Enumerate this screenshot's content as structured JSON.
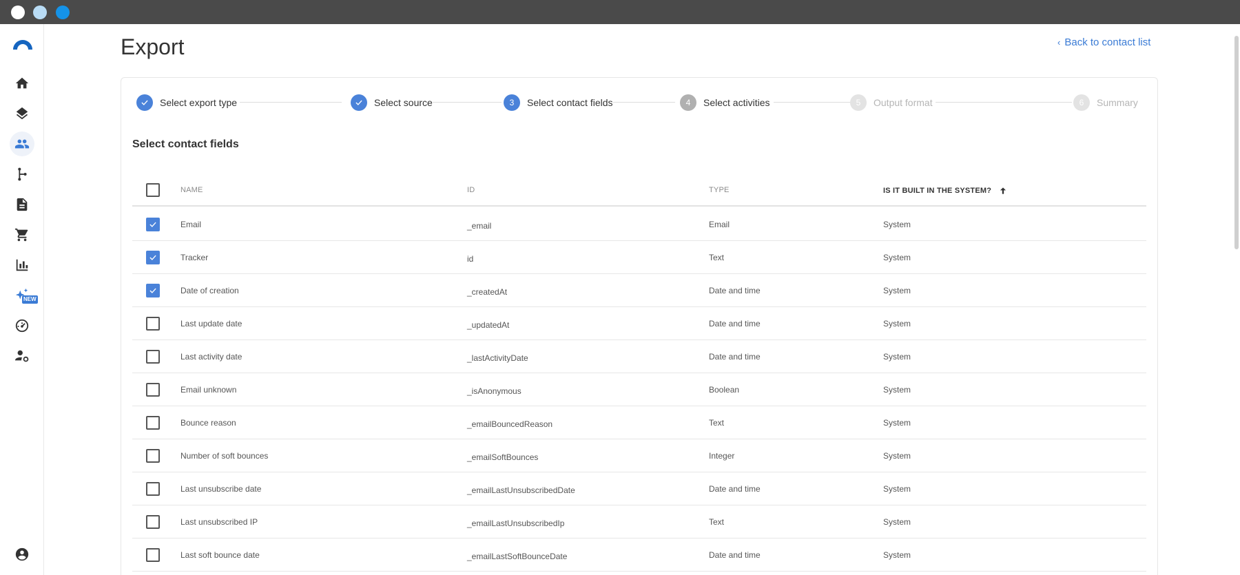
{
  "page": {
    "title": "Export",
    "back_link": "Back to contact list"
  },
  "stepper": [
    {
      "number": "1",
      "label": "Select export type",
      "state": "done"
    },
    {
      "number": "2",
      "label": "Select source",
      "state": "done"
    },
    {
      "number": "3",
      "label": "Select contact fields",
      "state": "current"
    },
    {
      "number": "4",
      "label": "Select activities",
      "state": "next"
    },
    {
      "number": "5",
      "label": "Output format",
      "state": "far"
    },
    {
      "number": "6",
      "label": "Summary",
      "state": "far"
    }
  ],
  "section_title": "Select contact fields",
  "table": {
    "headers": {
      "name": "NAME",
      "id": "ID",
      "type": "TYPE",
      "built_in": "IS IT BUILT IN THE SYSTEM?"
    },
    "rows": [
      {
        "name": "Email",
        "id": "_email",
        "type": "Email",
        "built_in": "System",
        "checked": true
      },
      {
        "name": "Tracker",
        "id": "id",
        "type": "Text",
        "built_in": "System",
        "checked": true
      },
      {
        "name": "Date of creation",
        "id": "_createdAt",
        "type": "Date and time",
        "built_in": "System",
        "checked": true
      },
      {
        "name": "Last update date",
        "id": "_updatedAt",
        "type": "Date and time",
        "built_in": "System",
        "checked": false
      },
      {
        "name": "Last activity date",
        "id": "_lastActivityDate",
        "type": "Date and time",
        "built_in": "System",
        "checked": false
      },
      {
        "name": "Email unknown",
        "id": "_isAnonymous",
        "type": "Boolean",
        "built_in": "System",
        "checked": false
      },
      {
        "name": "Bounce reason",
        "id": "_emailBouncedReason",
        "type": "Text",
        "built_in": "System",
        "checked": false
      },
      {
        "name": "Number of soft bounces",
        "id": "_emailSoftBounces",
        "type": "Integer",
        "built_in": "System",
        "checked": false
      },
      {
        "name": "Last unsubscribe date",
        "id": "_emailLastUnsubscribedDate",
        "type": "Date and time",
        "built_in": "System",
        "checked": false
      },
      {
        "name": "Last unsubscribed IP",
        "id": "_emailLastUnsubscribedIp",
        "type": "Text",
        "built_in": "System",
        "checked": false
      },
      {
        "name": "Last soft bounce date",
        "id": "_emailLastSoftBounceDate",
        "type": "Date and time",
        "built_in": "System",
        "checked": false
      }
    ]
  },
  "sidebar": {
    "items": [
      {
        "icon": "home-icon"
      },
      {
        "icon": "layers-icon"
      },
      {
        "icon": "contacts-icon",
        "active": true
      },
      {
        "icon": "workflow-icon"
      },
      {
        "icon": "document-icon"
      },
      {
        "icon": "cart-icon"
      },
      {
        "icon": "bar-chart-icon"
      },
      {
        "icon": "sparkle-icon",
        "badge": "NEW"
      },
      {
        "icon": "gauge-icon"
      },
      {
        "icon": "user-settings-icon"
      }
    ],
    "bottom": {
      "icon": "account-icon"
    }
  },
  "colors": {
    "accent": "#4a82d9",
    "link": "#3a7bd5",
    "titlebar": "#4a4a4a"
  }
}
